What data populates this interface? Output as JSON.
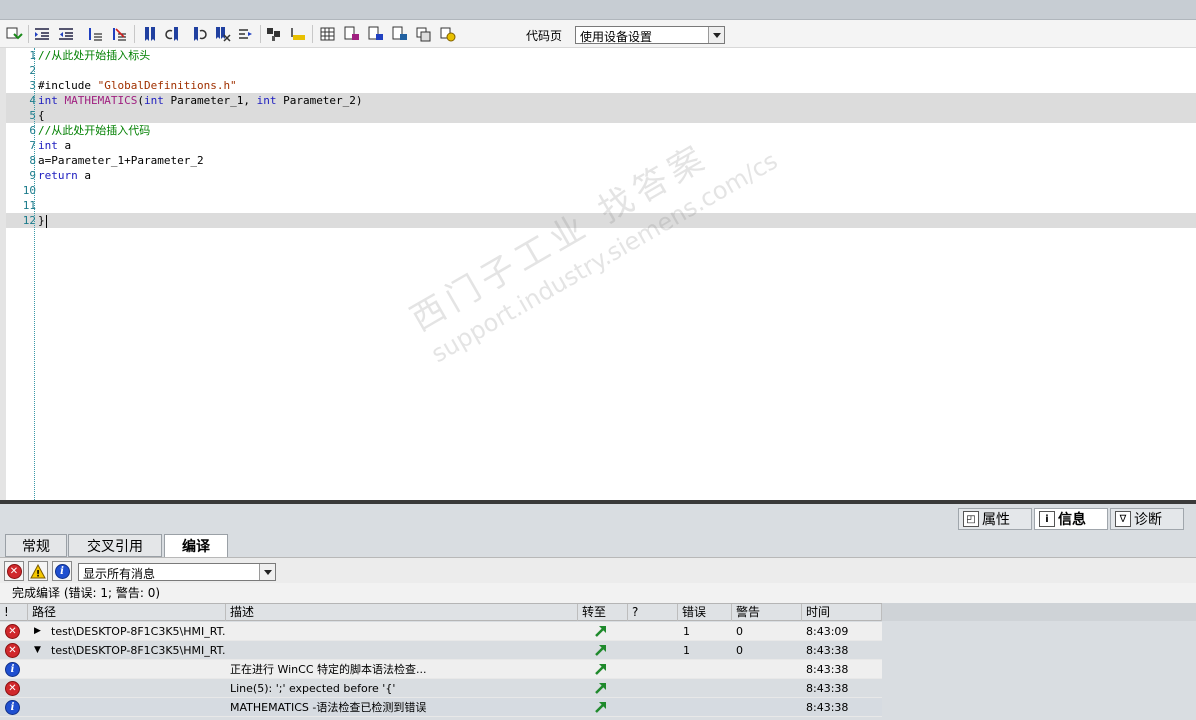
{
  "toolbar": {
    "codepage_label": "代码页",
    "codepage_value": "使用设备设置",
    "icons": [
      "compile-icon",
      "indent-icon",
      "outdent-icon",
      "comment-icon",
      "uncomment-icon",
      "bookmark-icon",
      "bookmark-prev-icon",
      "bookmark-next-icon",
      "bookmark-clear-icon",
      "goto-line-icon",
      "find-icon",
      "highlight-icon",
      "tags-icon",
      "snippet-icon",
      "insert-icon",
      "insert2-icon",
      "properties-icon",
      "wizard-icon"
    ]
  },
  "editor": {
    "lines": [
      {
        "n": "1",
        "text": "//从此处开始插入标头"
      },
      {
        "n": "2",
        "text": ""
      },
      {
        "n": "3",
        "text": "#include \"GlobalDefinitions.h\""
      },
      {
        "n": "4",
        "text": "int MATHEMATICS(int Parameter_1, int Parameter_2)"
      },
      {
        "n": "5",
        "text": "{"
      },
      {
        "n": "6",
        "text": "//从此处开始插入代码"
      },
      {
        "n": "7",
        "text": "int a"
      },
      {
        "n": "8",
        "text": "a=Parameter_1+Parameter_2"
      },
      {
        "n": "9",
        "text": "return a"
      },
      {
        "n": "10",
        "text": ""
      },
      {
        "n": "11",
        "text": ""
      },
      {
        "n": "12",
        "text": "}"
      }
    ]
  },
  "watermark": {
    "line1": "西门子工业  找答案",
    "line2": "support.industry.siemens.com/cs"
  },
  "inspector_tabs": {
    "properties": "属性",
    "info": "信息",
    "diagnostics": "诊断"
  },
  "sub_tabs": {
    "general": "常规",
    "cross_ref": "交叉引用",
    "compile": "编译"
  },
  "filter": {
    "value": "显示所有消息"
  },
  "summary": "完成编译 (错误: 1; 警告: 0)",
  "columns": {
    "bang": "!",
    "path": "路径",
    "desc": "描述",
    "goto": "转至",
    "q": "?",
    "errors": "错误",
    "warnings": "警告",
    "time": "时间"
  },
  "rows": [
    {
      "status": "error",
      "expander": "▶",
      "path": "test\\DESKTOP-8F1C3K5\\HMI_RT...",
      "desc": "",
      "errors": "1",
      "warnings": "0",
      "time": "8:43:09"
    },
    {
      "status": "error",
      "expander": "▼",
      "path": "test\\DESKTOP-8F1C3K5\\HMI_RT...",
      "desc": "",
      "errors": "1",
      "warnings": "0",
      "time": "8:43:38"
    },
    {
      "status": "info",
      "expander": "",
      "path": "",
      "desc": "正在进行 WinCC 特定的脚本语法检查...",
      "errors": "",
      "warnings": "",
      "time": "8:43:38"
    },
    {
      "status": "error",
      "expander": "",
      "path": "",
      "desc": "Line(5):  ';' expected before '{'",
      "errors": "",
      "warnings": "",
      "time": "8:43:38"
    },
    {
      "status": "info",
      "expander": "",
      "path": "",
      "desc": "MATHEMATICS -语法检查已检测到错误",
      "errors": "",
      "warnings": "",
      "time": "8:43:38"
    }
  ],
  "colors": {
    "error": "#d0282c",
    "info": "#1f4fd0",
    "goto_arrow": "#1f8a2c",
    "line_number": "#1a7a8a"
  }
}
